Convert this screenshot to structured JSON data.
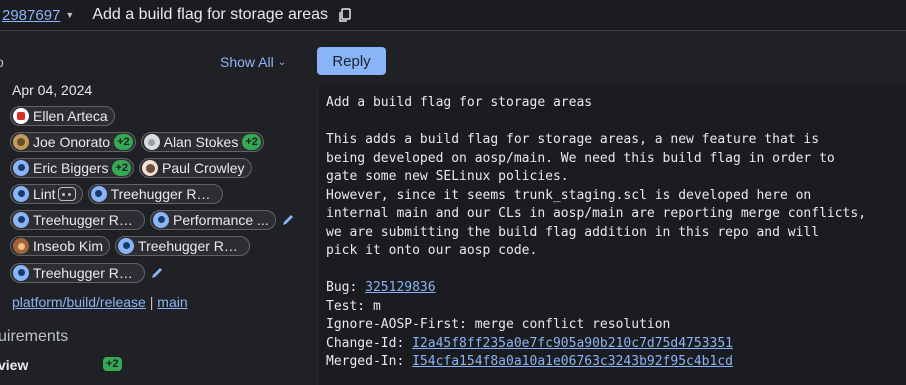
{
  "header": {
    "change_number": "2987697",
    "subject": "Add a build flag for storage areas"
  },
  "left": {
    "cut_label": "o",
    "show_all": "Show All",
    "date": "Apr 04, 2024",
    "reviewers": [
      {
        "name": "Ellen Arteca"
      },
      {
        "name": "Joe Onorato",
        "badge": "+2"
      },
      {
        "name": "Alan Stokes",
        "badge": "+2"
      },
      {
        "name": "Eric Biggers",
        "badge": "+2"
      },
      {
        "name": "Paul Crowley"
      },
      {
        "name": "Lint"
      },
      {
        "name": "Treehugger Ro..."
      },
      {
        "name": "Treehugger Ro..."
      },
      {
        "name": "Performance ..."
      },
      {
        "name": "Inseob Kim"
      },
      {
        "name": "Treehugger Ro..."
      },
      {
        "name": "Treehugger Ro..."
      }
    ],
    "repo": "platform/build/release",
    "separator": "|",
    "branch": "main",
    "requirements_label": "uirements",
    "review_label": "view",
    "review_badge": "+2"
  },
  "reply_label": "Reply",
  "message": {
    "title": "Add a build flag for storage areas",
    "body": [
      "This adds a build flag for storage areas, a new feature that is",
      "being developed on aosp/main. We need this build flag in order to",
      "gate some new SELinux policies.",
      "However, since it seems trunk_staging.scl is developed here on",
      "internal main and our CLs in aosp/main are reporting merge conflicts,",
      "we are submitting the build flag addition in this repo and will",
      "pick it onto our aosp code."
    ],
    "bug_label": "Bug: ",
    "bug_value": "325129836",
    "test_line": "Test: m",
    "ignore_line": "Ignore-AOSP-First: merge conflict resolution",
    "change_id_label": "Change-Id: ",
    "change_id_value": "I2a45f8ff235a0e7fc905a90b210c7d75d4753351",
    "merged_in_label": "Merged-In: ",
    "merged_in_value": "I54cfa154f8a0a10a1e06763c3243b92f95c4b1cd"
  },
  "colors": {
    "background": "#202124",
    "accent": "#8ab4f8",
    "vote_green": "#34a853"
  }
}
